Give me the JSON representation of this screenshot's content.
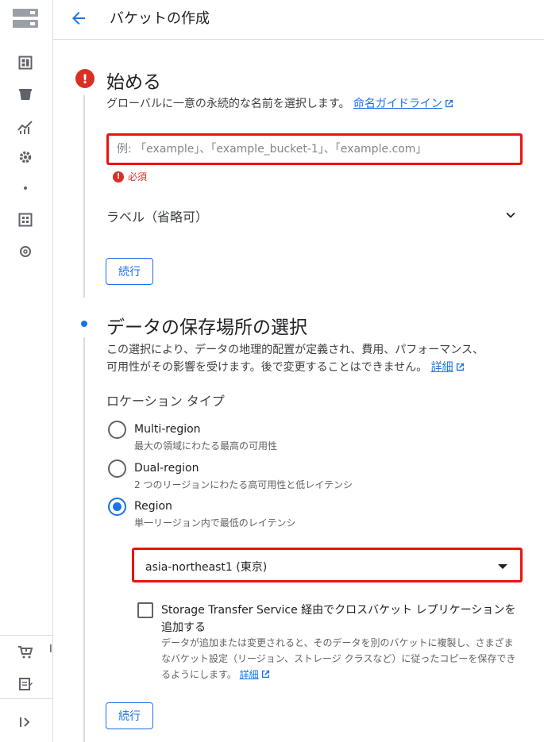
{
  "header": {
    "title": "バケットの作成"
  },
  "rail": {
    "truncated_label": "I"
  },
  "step1": {
    "title": "始める",
    "description": "グローバルに一意の永続的な名前を選択します。",
    "guide_link": "命名ガイドライン",
    "name_input": {
      "value": "",
      "placeholder": "例: 「example」、「example_bucket-1」、「example.com」"
    },
    "required_text": "必須",
    "labels_toggle": "ラベル（省略可）",
    "continue_label": "続行"
  },
  "step2": {
    "title": "データの保存場所の選択",
    "description_line1": "この選択により、データの地理的配置が定義され、費用、パフォーマンス、",
    "description_line2": "可用性がその影響を受けます。後で変更することはできません。",
    "details_link": "詳細",
    "location_type_label": "ロケーション タイプ",
    "options": [
      {
        "title": "Multi-region",
        "subtitle": "最大の領域にわたる最高の可用性",
        "checked": false
      },
      {
        "title": "Dual-region",
        "subtitle": "2 つのリージョンにわたる高可用性と低レイテンシ",
        "checked": false
      },
      {
        "title": "Region",
        "subtitle": "単一リージョン内で最低のレイテンシ",
        "checked": true
      }
    ],
    "region_select": {
      "value": "asia-northeast1 (東京)"
    },
    "replication": {
      "checked": false,
      "title": "Storage Transfer Service 経由でクロスバケット レプリケーションを追加する",
      "description": "データが追加または変更されると、そのデータを別のバケットに複製し、さまざまなバケット設定（リージョン、ストレージ クラスなど）に従ったコピーを保存できるようにします。",
      "details_link": "詳細"
    },
    "continue_label": "続行"
  },
  "colors": {
    "accent": "#1a73e8",
    "error": "#d93025",
    "highlight": "#e8150f"
  }
}
